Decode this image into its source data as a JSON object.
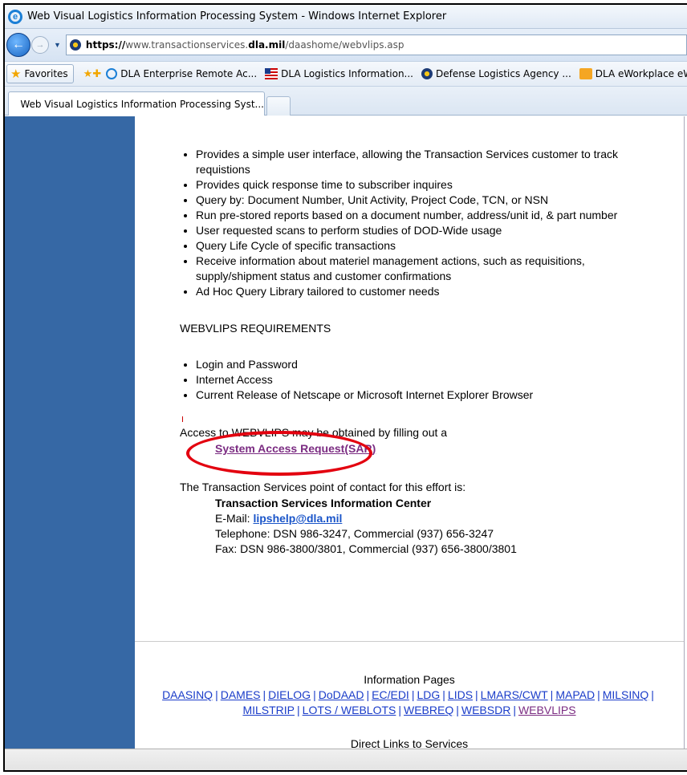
{
  "window": {
    "title": "Web Visual Logistics Information Processing System - Windows Internet Explorer"
  },
  "address_bar": {
    "url_scheme": "https://",
    "url_host_prefix": "www.transactionservices.",
    "url_host_domain": "dla.mil",
    "url_path": "/daashome/webvlips.asp"
  },
  "favorites_bar": {
    "favorites_label": "Favorites",
    "links": [
      {
        "label": "DLA Enterprise Remote Ac...",
        "icon": "ie-icon"
      },
      {
        "label": "DLA Logistics Information...",
        "icon": "flag-icon"
      },
      {
        "label": "Defense Logistics Agency ...",
        "icon": "seal-icon"
      },
      {
        "label": "DLA eWorkplace eWorkpl",
        "icon": "eworkplace-icon"
      }
    ]
  },
  "tab": {
    "label": "Web Visual Logistics Information Processing Syst..."
  },
  "page": {
    "features": [
      "Provides a simple user interface, allowing the Transaction Services customer to track requistions",
      "Provides quick response time to subscriber inquires",
      "Query by: Document Number, Unit Activity, Project Code, TCN, or NSN",
      "Run pre-stored reports based on a document number, address/unit id, & part number",
      "User requested scans to perform studies of DOD-Wide usage",
      "Query Life Cycle of specific transactions",
      "Receive information about materiel management actions, such as requisitions, supply/shipment status and customer confirmations",
      "Ad Hoc Query Library tailored to customer needs"
    ],
    "requirements_heading": "WEBVLIPS REQUIREMENTS",
    "requirements": [
      "Login and Password",
      "Internet Access",
      "Current Release of Netscape or Microsoft Internet Explorer Browser"
    ],
    "access_text": "Access to WEBVLIPS may be obtained by filling out a",
    "sar_link": "System Access Request(SAR)",
    "poc_text": "The Transaction Services point of contact for this effort is:",
    "poc_name": "Transaction Services Information Center",
    "email_label": "E-Mail: ",
    "email_link": "lipshelp@dla.mil",
    "telephone": "Telephone: DSN 986-3247, Commercial (937) 656-3247",
    "fax": "Fax: DSN 986-3800/3801, Commercial (937) 656-3800/3801",
    "info_pages_title": "Information Pages",
    "info_links_row1": [
      "DAASINQ",
      "DAMES",
      "DIELOG",
      "DoDAAD",
      "EC/EDI",
      "LDG",
      "LIDS",
      "LMARS/CWT",
      "MAPAD",
      "MILSINQ"
    ],
    "info_links_row2": [
      "MILSTRIP",
      "LOTS / WEBLOTS",
      "WEBREQ",
      "WEBSDR",
      "WEBVLIPS"
    ],
    "direct_links_title": "Direct Links to Services"
  },
  "colors": {
    "sidebar": "#3668a5",
    "annotation_ellipse": "#e3000f",
    "visited_link": "#7b2c82",
    "link": "#1a3cc9"
  }
}
